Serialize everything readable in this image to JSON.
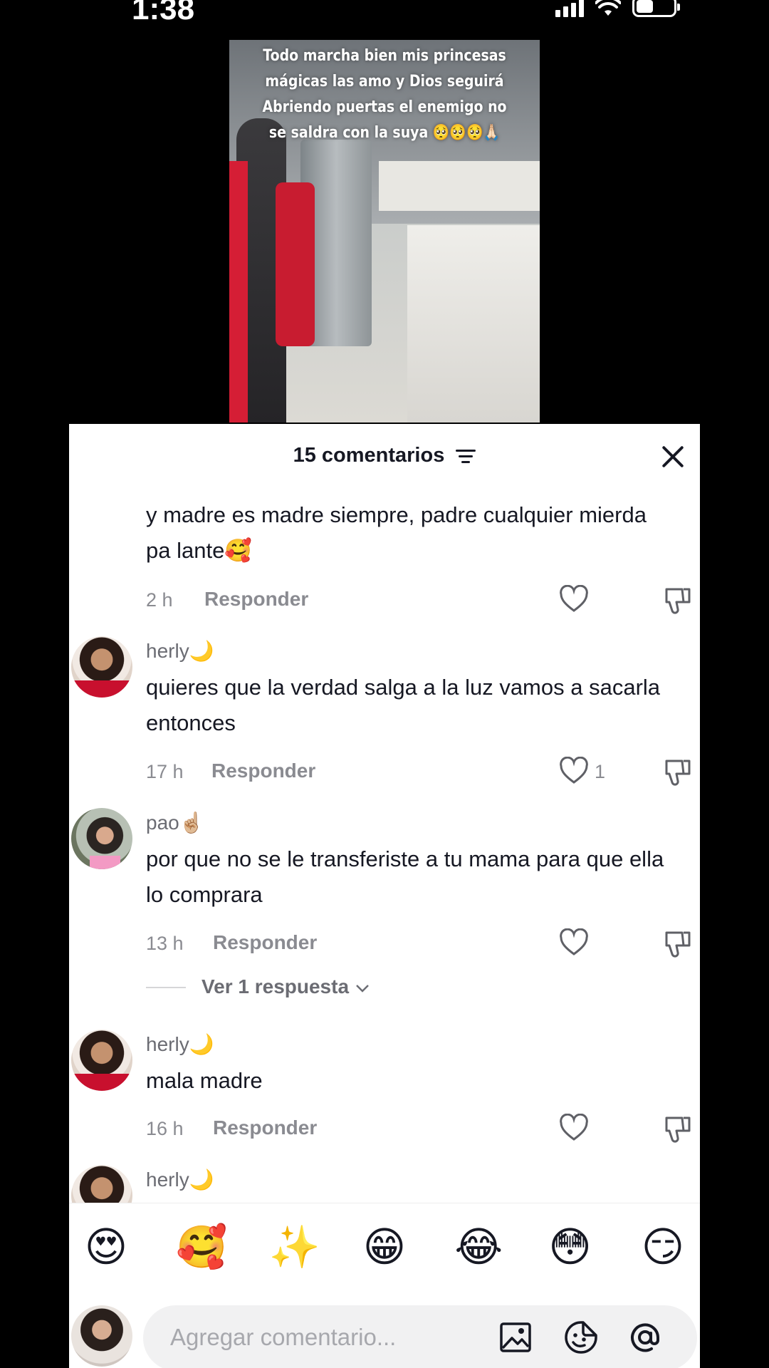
{
  "status": {
    "time": "1:38"
  },
  "video": {
    "caption": "Todo marcha bien mis princesas mágicas las amo y Dios seguirá Abriendo puertas el enemigo no se saldra con la suya 🥺🥺🥺🙏🏻"
  },
  "sheet": {
    "title": "15 comentarios",
    "comments": [
      {
        "user": "",
        "text": "y madre es madre siempre, padre cualquier mierda pa lante🥰",
        "time": "2 h",
        "reply_label": "Responder",
        "likes": ""
      },
      {
        "user": "herly🌙",
        "text": "quieres que la verdad salga a la luz vamos a sacarla entonces",
        "time": "17 h",
        "reply_label": "Responder",
        "likes": "1"
      },
      {
        "user": "pao☝🏼",
        "text": "por que no se le transferiste a tu mama para que ella lo comprara",
        "time": "13 h",
        "reply_label": "Responder",
        "likes": "",
        "view_replies": "Ver 1 respuesta"
      },
      {
        "user": "herly🌙",
        "text": "mala madre",
        "time": "16 h",
        "reply_label": "Responder",
        "likes": ""
      },
      {
        "user": "herly🌙",
        "text": "",
        "time": "",
        "reply_label": "",
        "likes": ""
      }
    ],
    "quick_emojis": [
      "😍",
      "🥰",
      "✨",
      "😁",
      "😂",
      "😳",
      "😏"
    ],
    "input_placeholder": "Agregar comentario..."
  },
  "icons": [
    "filter-icon",
    "close-icon",
    "heart-icon",
    "dislike-icon",
    "chevron-down-icon",
    "image-icon",
    "sticker-icon",
    "mention-icon"
  ]
}
